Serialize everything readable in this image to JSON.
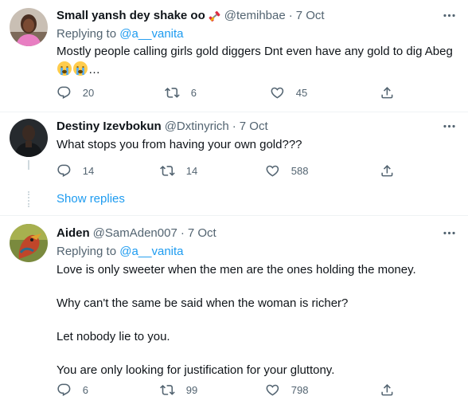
{
  "tweets": [
    {
      "name": "Small yansh dey shake oo",
      "badge_icon": "dumbbell-emoji",
      "handle": "@temihbae",
      "sep": "·",
      "date": "7 Oct",
      "replying_prefix": "Replying to",
      "replying_to": "@a__vanita",
      "text": "Mostly people calling girls gold diggers Dnt even have any gold to dig Abeg",
      "text_suffix": "…",
      "emojis": [
        "loudly-crying-face",
        "loudly-crying-face"
      ],
      "replies": "20",
      "retweets": "6",
      "likes": "45"
    },
    {
      "name": "Destiny Izevbokun",
      "handle": "@Dxtinyrich",
      "sep": "·",
      "date": "7 Oct",
      "text": "What stops you from having your own gold???",
      "replies": "14",
      "retweets": "14",
      "likes": "588"
    },
    {
      "name": "Aiden",
      "handle": "@SamAden007",
      "sep": "·",
      "date": "7 Oct",
      "replying_prefix": "Replying to",
      "replying_to": "@a__vanita",
      "paragraphs": [
        "Love is only sweeter when the men are the ones holding the money.",
        "Why can't the same be said when the woman is richer?",
        "Let nobody lie to you.",
        "You are only looking for justification for your gluttony."
      ],
      "replies": "6",
      "retweets": "99",
      "likes": "798"
    }
  ],
  "show_replies": "Show replies",
  "colors": {
    "accent": "#1d9bf0",
    "secondary": "#536471",
    "divider": "#eff3f4",
    "thread": "#cfd9de"
  }
}
